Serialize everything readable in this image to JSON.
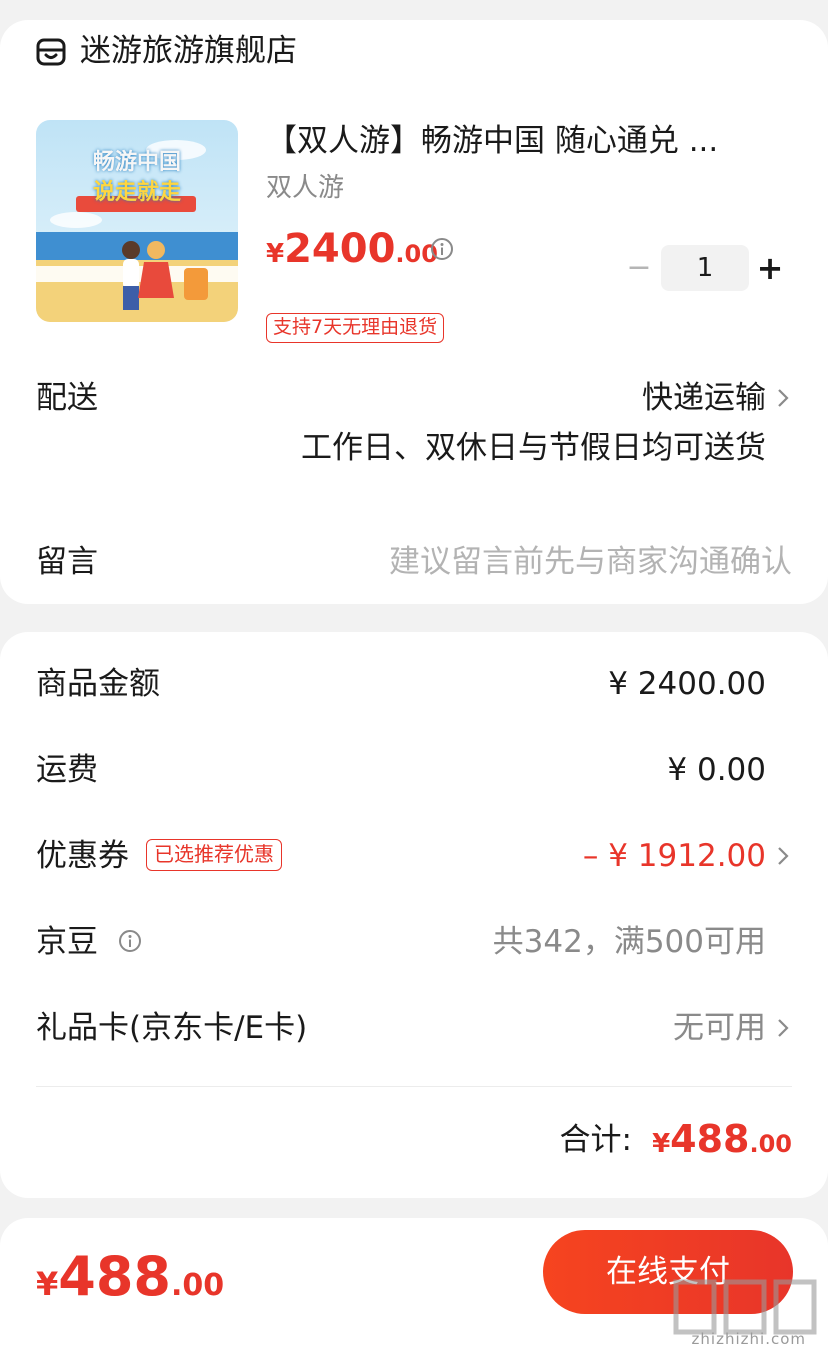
{
  "shop": {
    "icon": "store-icon",
    "name": "迷游旅游旗舰店"
  },
  "product": {
    "image_title": "畅游中国",
    "image_subtitle": "说走就走",
    "title": "【双人游】畅游中国 随心通兑 ...",
    "spec": "双人游",
    "price_symbol": "¥",
    "price_integer": "2400",
    "price_decimal": ".00",
    "quantity": "1",
    "minus": "−",
    "plus": "+",
    "return_tag": "支持7天无理由退货"
  },
  "delivery": {
    "label": "配送",
    "method": "快递运输",
    "note": "工作日、双休日与节假日均可送货"
  },
  "remark": {
    "label": "留言",
    "placeholder": "建议留言前先与商家沟通确认"
  },
  "summary": {
    "goods_label": "商品金额",
    "goods_value": "¥ 2400.00",
    "shipping_label": "运费",
    "shipping_value": "¥ 0.00",
    "coupon_label": "优惠券",
    "coupon_tag": "已选推荐优惠",
    "coupon_value": "– ¥ 1912.00",
    "beans_label": "京豆",
    "beans_value": "共342，满500可用",
    "giftcard_label": "礼品卡(京东卡/E卡)",
    "giftcard_value": "无可用",
    "total_label": "合计:",
    "total_symbol": "¥",
    "total_integer": "488",
    "total_decimal": ".00"
  },
  "bottom": {
    "price_symbol": "¥",
    "price_integer": "488",
    "price_decimal": ".00",
    "pay_label": "在线支付"
  },
  "watermark": {
    "text": "zhizhizhi.com"
  },
  "colors": {
    "accent": "#e8352a",
    "background": "#f2f2f2",
    "muted_text": "#8a8a8a"
  }
}
